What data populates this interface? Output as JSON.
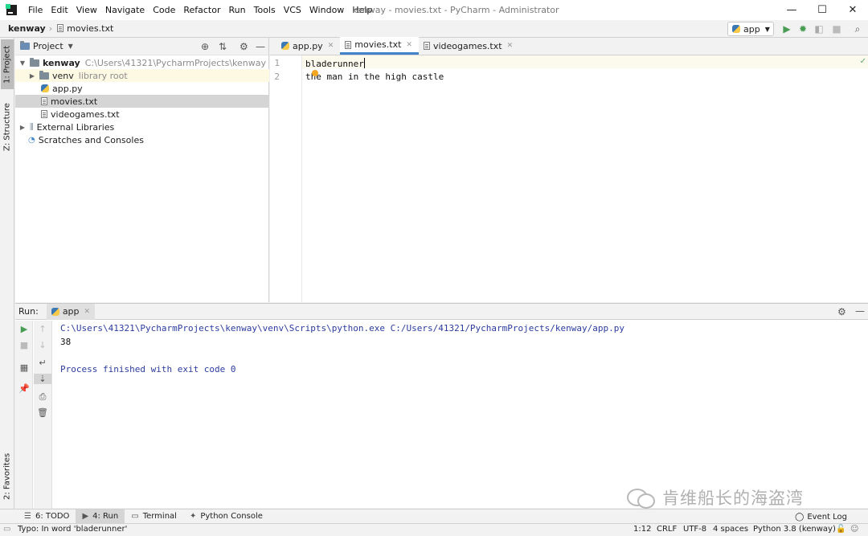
{
  "window": {
    "title": "kenway - movies.txt - PyCharm - Administrator",
    "minimize": "—",
    "maximize": "☐",
    "close": "✕"
  },
  "menu": [
    "File",
    "Edit",
    "View",
    "Navigate",
    "Code",
    "Refactor",
    "Run",
    "Tools",
    "VCS",
    "Window",
    "Help"
  ],
  "navbar": {
    "project": "kenway",
    "file": "movies.txt",
    "run_config": "app"
  },
  "sidebar_tabs": {
    "project": "1: Project",
    "structure": "Z: Structure",
    "favorites": "2: Favorites"
  },
  "project_panel": {
    "title": "Project",
    "tree": [
      {
        "label": "kenway",
        "detail": "C:\\Users\\41321\\PycharmProjects\\kenway"
      },
      {
        "label": "venv",
        "detail": "library root"
      },
      {
        "label": "app.py"
      },
      {
        "label": "movies.txt"
      },
      {
        "label": "videogames.txt"
      },
      {
        "label": "External Libraries"
      },
      {
        "label": "Scratches and Consoles"
      }
    ]
  },
  "editor": {
    "tabs": [
      "app.py",
      "movies.txt",
      "videogames.txt"
    ],
    "active_tab": "movies.txt",
    "line_numbers": [
      "1",
      "2"
    ],
    "lines": [
      "bladerunner",
      "the man in the high castle"
    ]
  },
  "run_panel": {
    "label": "Run:",
    "tab": "app",
    "console": [
      "C:\\Users\\41321\\PycharmProjects\\kenway\\venv\\Scripts\\python.exe C:/Users/41321/PycharmProjects/kenway/app.py",
      "38",
      "Process finished with exit code 0"
    ]
  },
  "bottom_tabs": [
    "6: TODO",
    "4: Run",
    "Terminal",
    "Python Console"
  ],
  "event_log": "Event Log",
  "statusbar": {
    "message": "Typo: In word 'bladerunner'",
    "position": "1:12",
    "line_ending": "CRLF",
    "encoding": "UTF-8",
    "indent": "4 spaces",
    "interpreter": "Python 3.8 (kenway)"
  },
  "watermark": "肯维船长的海盗湾",
  "colors": {
    "accent": "#4083c9",
    "console_info": "#2b3c9e",
    "run_green": "#499c54"
  }
}
